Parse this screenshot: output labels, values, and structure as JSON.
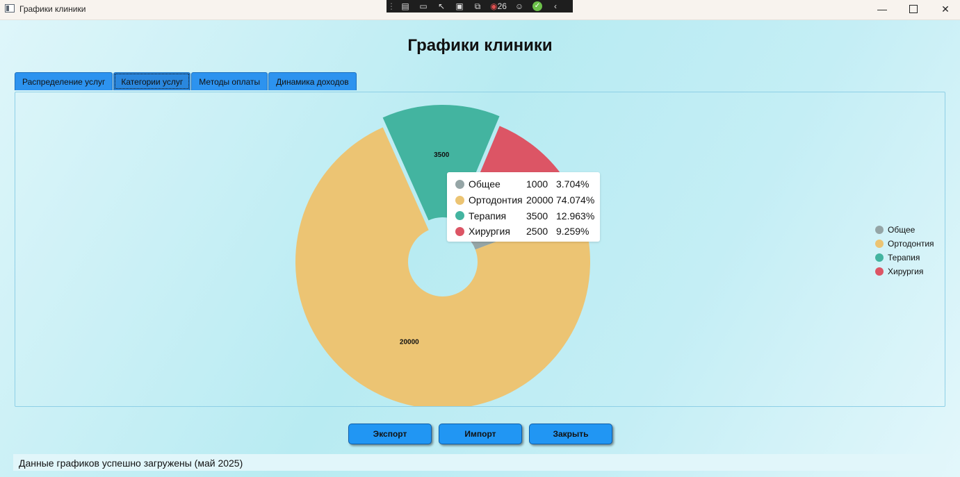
{
  "window": {
    "title": "Графики клиники"
  },
  "debug_toolbar": {
    "count": "26"
  },
  "page": {
    "title": "Графики клиники"
  },
  "tabs": [
    {
      "label": "Распределение услуг",
      "active": false
    },
    {
      "label": "Категории услуг",
      "active": true
    },
    {
      "label": "Методы оплаты",
      "active": false
    },
    {
      "label": "Динамика доходов",
      "active": false
    }
  ],
  "chart_data": {
    "type": "pie",
    "variant": "doughnut",
    "categories": [
      "Общее",
      "Ортодонтия",
      "Терапия",
      "Хирургия"
    ],
    "values": [
      1000,
      20000,
      3500,
      2500
    ],
    "percents": [
      "3.704%",
      "74.074%",
      "12.963%",
      "9.259%"
    ],
    "data_labels": [
      "1000",
      "20000",
      "3500",
      "2500"
    ],
    "colors": [
      "#95a5a6",
      "#ecc473",
      "#43b4a0",
      "#dc5565"
    ],
    "exploded": "Терапия",
    "legend": "right"
  },
  "tooltip": {
    "rows": [
      {
        "name": "Общее",
        "value": "1000",
        "percent": "3.704%"
      },
      {
        "name": "Ортодонтия",
        "value": "20000",
        "percent": "74.074%"
      },
      {
        "name": "Терапия",
        "value": "3500",
        "percent": "12.963%"
      },
      {
        "name": "Хирургия",
        "value": "2500",
        "percent": "9.259%"
      }
    ]
  },
  "buttons": {
    "export": "Экспорт",
    "import": "Импорт",
    "close": "Закрыть"
  },
  "status": {
    "text": "Данные графиков успешно загружены (май 2025)"
  }
}
